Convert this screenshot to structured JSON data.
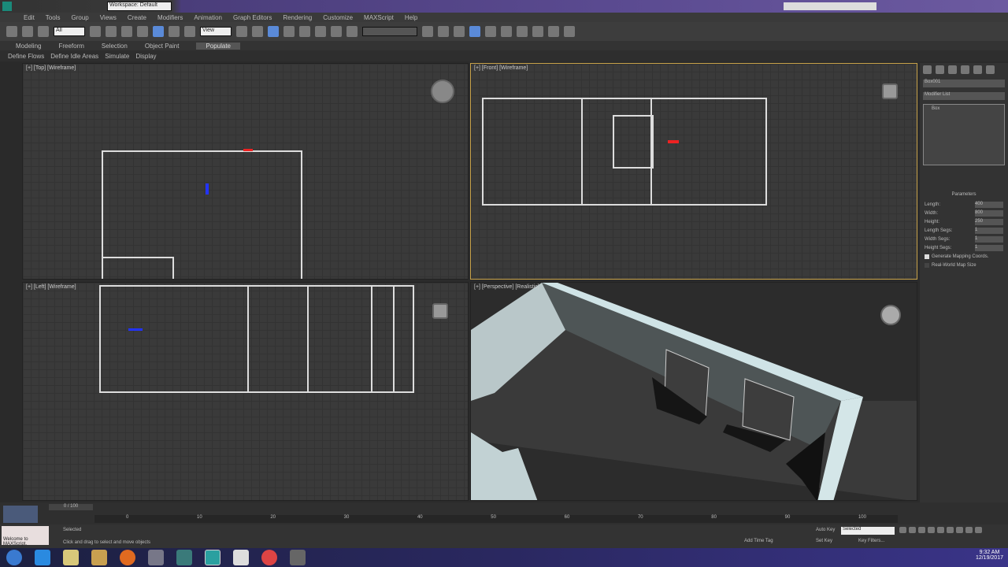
{
  "title": {
    "workspace": "Workspace: Default"
  },
  "menu": [
    "Edit",
    "Tools",
    "Group",
    "Views",
    "Create",
    "Modifiers",
    "Animation",
    "Graph Editors",
    "Rendering",
    "Customize",
    "MAXScript",
    "Help"
  ],
  "toolbar": {
    "selection_filter": "All",
    "ref_coord": "View"
  },
  "ribbon": {
    "tabs": [
      "Modeling",
      "Freeform",
      "Selection",
      "Object Paint",
      "Populate"
    ],
    "active": 4,
    "sub": [
      "Define Flows",
      "Define Idle Areas",
      "Simulate",
      "Display"
    ]
  },
  "viewports": {
    "top": "[+] [Top] [Wireframe]",
    "front": "[+] [Front] [Wireframe]",
    "left": "[+] [Left] [Wireframe]",
    "persp": "[+] [Perspective] [Realistic]"
  },
  "command_panel": {
    "object_name": "Box001",
    "modifier_list": "Modifier List",
    "stack_item": "Box",
    "rollout": "Parameters",
    "params": [
      {
        "label": "Length:",
        "value": "400"
      },
      {
        "label": "Width:",
        "value": "800"
      },
      {
        "label": "Height:",
        "value": "250"
      },
      {
        "label": "Length Segs:",
        "value": "1"
      },
      {
        "label": "Width Segs:",
        "value": "1"
      },
      {
        "label": "Height Segs:",
        "value": "1"
      }
    ],
    "checks": [
      {
        "label": "Generate Mapping Coords.",
        "checked": true
      },
      {
        "label": "Real-World Map Size",
        "checked": false
      }
    ]
  },
  "timeline": {
    "frame": "0 / 100",
    "ticks": [
      "0",
      "10",
      "20",
      "30",
      "40",
      "50",
      "60",
      "70",
      "80",
      "90",
      "100"
    ]
  },
  "status": {
    "script_prompt": "Welcome to MAXScript.",
    "hint": "Click and drag to select and move objects",
    "auto_key": "Auto Key",
    "selected": "Selected",
    "set_key": "Set Key",
    "key_filters": "Key Filters...",
    "add_time_tag": "Add Time Tag"
  },
  "taskbar": {
    "time": "9:32 AM",
    "date": "12/19/2017"
  }
}
